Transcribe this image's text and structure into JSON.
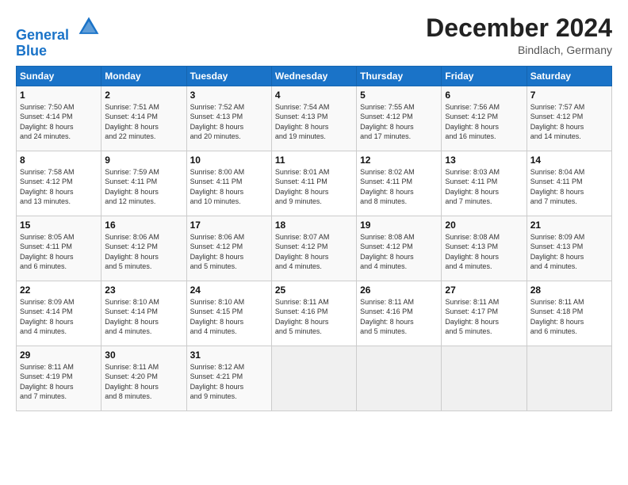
{
  "header": {
    "logo_line1": "General",
    "logo_line2": "Blue",
    "month_title": "December 2024",
    "location": "Bindlach, Germany"
  },
  "weekdays": [
    "Sunday",
    "Monday",
    "Tuesday",
    "Wednesday",
    "Thursday",
    "Friday",
    "Saturday"
  ],
  "weeks": [
    [
      {
        "day": "1",
        "info": "Sunrise: 7:50 AM\nSunset: 4:14 PM\nDaylight: 8 hours\nand 24 minutes."
      },
      {
        "day": "2",
        "info": "Sunrise: 7:51 AM\nSunset: 4:14 PM\nDaylight: 8 hours\nand 22 minutes."
      },
      {
        "day": "3",
        "info": "Sunrise: 7:52 AM\nSunset: 4:13 PM\nDaylight: 8 hours\nand 20 minutes."
      },
      {
        "day": "4",
        "info": "Sunrise: 7:54 AM\nSunset: 4:13 PM\nDaylight: 8 hours\nand 19 minutes."
      },
      {
        "day": "5",
        "info": "Sunrise: 7:55 AM\nSunset: 4:12 PM\nDaylight: 8 hours\nand 17 minutes."
      },
      {
        "day": "6",
        "info": "Sunrise: 7:56 AM\nSunset: 4:12 PM\nDaylight: 8 hours\nand 16 minutes."
      },
      {
        "day": "7",
        "info": "Sunrise: 7:57 AM\nSunset: 4:12 PM\nDaylight: 8 hours\nand 14 minutes."
      }
    ],
    [
      {
        "day": "8",
        "info": "Sunrise: 7:58 AM\nSunset: 4:12 PM\nDaylight: 8 hours\nand 13 minutes."
      },
      {
        "day": "9",
        "info": "Sunrise: 7:59 AM\nSunset: 4:11 PM\nDaylight: 8 hours\nand 12 minutes."
      },
      {
        "day": "10",
        "info": "Sunrise: 8:00 AM\nSunset: 4:11 PM\nDaylight: 8 hours\nand 10 minutes."
      },
      {
        "day": "11",
        "info": "Sunrise: 8:01 AM\nSunset: 4:11 PM\nDaylight: 8 hours\nand 9 minutes."
      },
      {
        "day": "12",
        "info": "Sunrise: 8:02 AM\nSunset: 4:11 PM\nDaylight: 8 hours\nand 8 minutes."
      },
      {
        "day": "13",
        "info": "Sunrise: 8:03 AM\nSunset: 4:11 PM\nDaylight: 8 hours\nand 7 minutes."
      },
      {
        "day": "14",
        "info": "Sunrise: 8:04 AM\nSunset: 4:11 PM\nDaylight: 8 hours\nand 7 minutes."
      }
    ],
    [
      {
        "day": "15",
        "info": "Sunrise: 8:05 AM\nSunset: 4:11 PM\nDaylight: 8 hours\nand 6 minutes."
      },
      {
        "day": "16",
        "info": "Sunrise: 8:06 AM\nSunset: 4:12 PM\nDaylight: 8 hours\nand 5 minutes."
      },
      {
        "day": "17",
        "info": "Sunrise: 8:06 AM\nSunset: 4:12 PM\nDaylight: 8 hours\nand 5 minutes."
      },
      {
        "day": "18",
        "info": "Sunrise: 8:07 AM\nSunset: 4:12 PM\nDaylight: 8 hours\nand 4 minutes."
      },
      {
        "day": "19",
        "info": "Sunrise: 8:08 AM\nSunset: 4:12 PM\nDaylight: 8 hours\nand 4 minutes."
      },
      {
        "day": "20",
        "info": "Sunrise: 8:08 AM\nSunset: 4:13 PM\nDaylight: 8 hours\nand 4 minutes."
      },
      {
        "day": "21",
        "info": "Sunrise: 8:09 AM\nSunset: 4:13 PM\nDaylight: 8 hours\nand 4 minutes."
      }
    ],
    [
      {
        "day": "22",
        "info": "Sunrise: 8:09 AM\nSunset: 4:14 PM\nDaylight: 8 hours\nand 4 minutes."
      },
      {
        "day": "23",
        "info": "Sunrise: 8:10 AM\nSunset: 4:14 PM\nDaylight: 8 hours\nand 4 minutes."
      },
      {
        "day": "24",
        "info": "Sunrise: 8:10 AM\nSunset: 4:15 PM\nDaylight: 8 hours\nand 4 minutes."
      },
      {
        "day": "25",
        "info": "Sunrise: 8:11 AM\nSunset: 4:16 PM\nDaylight: 8 hours\nand 5 minutes."
      },
      {
        "day": "26",
        "info": "Sunrise: 8:11 AM\nSunset: 4:16 PM\nDaylight: 8 hours\nand 5 minutes."
      },
      {
        "day": "27",
        "info": "Sunrise: 8:11 AM\nSunset: 4:17 PM\nDaylight: 8 hours\nand 5 minutes."
      },
      {
        "day": "28",
        "info": "Sunrise: 8:11 AM\nSunset: 4:18 PM\nDaylight: 8 hours\nand 6 minutes."
      }
    ],
    [
      {
        "day": "29",
        "info": "Sunrise: 8:11 AM\nSunset: 4:19 PM\nDaylight: 8 hours\nand 7 minutes."
      },
      {
        "day": "30",
        "info": "Sunrise: 8:11 AM\nSunset: 4:20 PM\nDaylight: 8 hours\nand 8 minutes."
      },
      {
        "day": "31",
        "info": "Sunrise: 8:12 AM\nSunset: 4:21 PM\nDaylight: 8 hours\nand 9 minutes."
      },
      {
        "day": "",
        "info": ""
      },
      {
        "day": "",
        "info": ""
      },
      {
        "day": "",
        "info": ""
      },
      {
        "day": "",
        "info": ""
      }
    ]
  ]
}
